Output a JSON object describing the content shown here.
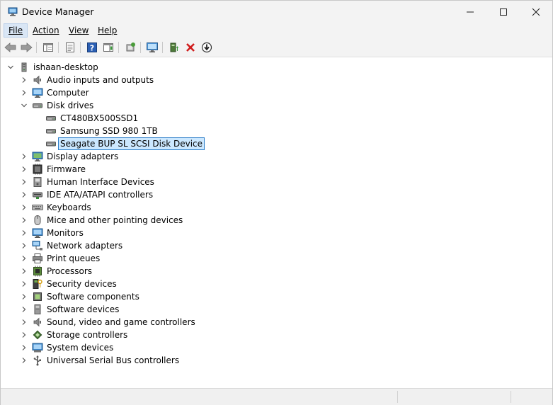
{
  "window": {
    "title": "Device Manager"
  },
  "menu": [
    {
      "label": "File",
      "active": true
    },
    {
      "label": "Action",
      "active": false
    },
    {
      "label": "View",
      "active": false
    },
    {
      "label": "Help",
      "active": false
    }
  ],
  "toolbar": [
    "back-icon",
    "forward-icon",
    "properties-view-icon",
    "device-properties-icon",
    "help-icon",
    "action-view-icon",
    "scan-hardware-icon",
    "monitor-icon",
    "update-driver-icon",
    "uninstall-icon",
    "download-icon"
  ],
  "tree": {
    "root": "ishaan-desktop",
    "categories": [
      {
        "label": "Audio inputs and outputs",
        "icon": "speaker-icon",
        "expanded": false
      },
      {
        "label": "Computer",
        "icon": "computer-icon",
        "expanded": false
      },
      {
        "label": "Disk drives",
        "icon": "disk-drive-icon",
        "expanded": true,
        "children": [
          {
            "label": "CT480BX500SSD1",
            "selected": false
          },
          {
            "label": "Samsung SSD 980 1TB",
            "selected": false
          },
          {
            "label": "Seagate BUP SL SCSI Disk Device",
            "selected": true
          }
        ]
      },
      {
        "label": "Display adapters",
        "icon": "display-adapter-icon",
        "expanded": false
      },
      {
        "label": "Firmware",
        "icon": "firmware-icon",
        "expanded": false
      },
      {
        "label": "Human Interface Devices",
        "icon": "hid-icon",
        "expanded": false
      },
      {
        "label": "IDE ATA/ATAPI controllers",
        "icon": "ide-controller-icon",
        "expanded": false
      },
      {
        "label": "Keyboards",
        "icon": "keyboard-icon",
        "expanded": false
      },
      {
        "label": "Mice and other pointing devices",
        "icon": "mouse-icon",
        "expanded": false
      },
      {
        "label": "Monitors",
        "icon": "monitor-icon",
        "expanded": false
      },
      {
        "label": "Network adapters",
        "icon": "network-icon",
        "expanded": false
      },
      {
        "label": "Print queues",
        "icon": "printer-icon",
        "expanded": false
      },
      {
        "label": "Processors",
        "icon": "processor-icon",
        "expanded": false
      },
      {
        "label": "Security devices",
        "icon": "security-icon",
        "expanded": false
      },
      {
        "label": "Software components",
        "icon": "software-component-icon",
        "expanded": false
      },
      {
        "label": "Software devices",
        "icon": "software-device-icon",
        "expanded": false
      },
      {
        "label": "Sound, video and game controllers",
        "icon": "sound-icon",
        "expanded": false
      },
      {
        "label": "Storage controllers",
        "icon": "storage-controller-icon",
        "expanded": false
      },
      {
        "label": "System devices",
        "icon": "system-device-icon",
        "expanded": false
      },
      {
        "label": "Universal Serial Bus controllers",
        "icon": "usb-icon",
        "expanded": false
      }
    ]
  }
}
